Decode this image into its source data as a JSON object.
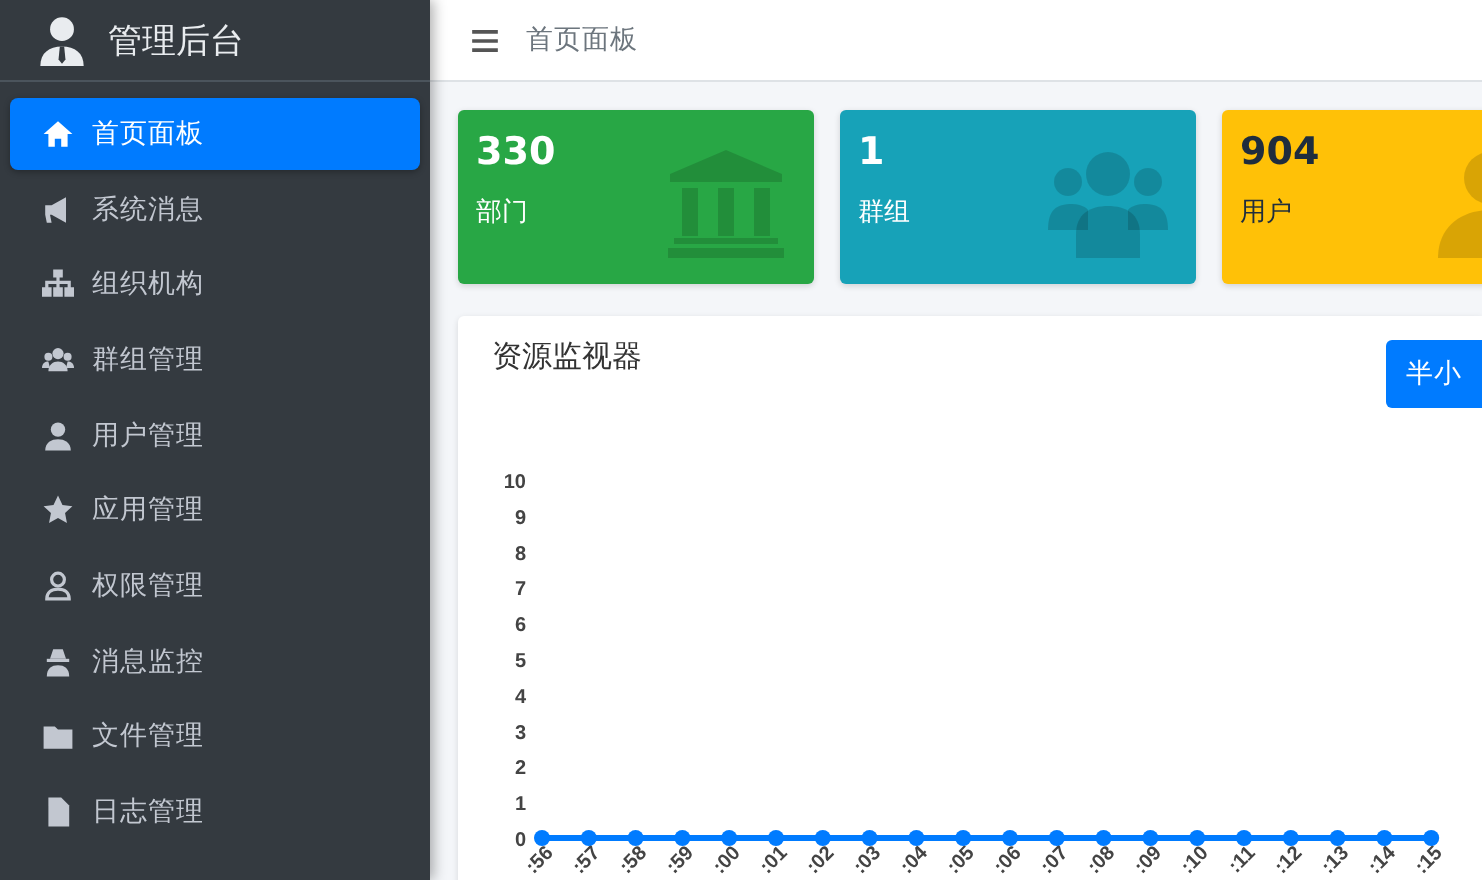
{
  "brand": {
    "title": "管理后台"
  },
  "sidebar": {
    "items": [
      {
        "label": "首页面板",
        "selected": true
      },
      {
        "label": "系统消息",
        "selected": false
      },
      {
        "label": "组织机构",
        "selected": false
      },
      {
        "label": "群组管理",
        "selected": false
      },
      {
        "label": "用户管理",
        "selected": false
      },
      {
        "label": "应用管理",
        "selected": false
      },
      {
        "label": "权限管理",
        "selected": false
      },
      {
        "label": "消息监控",
        "selected": false
      },
      {
        "label": "文件管理",
        "selected": false
      },
      {
        "label": "日志管理",
        "selected": false
      }
    ]
  },
  "topbar": {
    "breadcrumb": "首页面板"
  },
  "stat_cards": [
    {
      "value": "330",
      "label": "部门",
      "color": "#28a745"
    },
    {
      "value": "1",
      "label": "群组",
      "color": "#17a2b8"
    },
    {
      "value": "904",
      "label": "用户",
      "color": "#ffc107"
    }
  ],
  "monitor": {
    "title": "资源监视器",
    "button": "半小",
    "chart_data": {
      "type": "line",
      "categories": [
        ":56",
        ":57",
        ":58",
        ":59",
        ":00",
        ":01",
        ":02",
        ":03",
        ":04",
        ":05",
        ":06",
        ":07",
        ":08",
        ":09",
        ":10",
        ":11",
        ":12",
        ":13",
        ":14",
        ":15"
      ],
      "series": [
        {
          "color": "#007bff",
          "marker": true,
          "values": [
            0,
            0,
            0,
            0,
            0,
            0,
            0,
            0,
            0,
            0,
            0,
            0,
            0,
            0,
            0,
            0,
            0,
            0,
            0,
            0
          ]
        }
      ],
      "ylim": [
        0,
        10
      ],
      "yticks": [
        0,
        1,
        2,
        3,
        4,
        5,
        6,
        7,
        8,
        9,
        10
      ]
    }
  }
}
